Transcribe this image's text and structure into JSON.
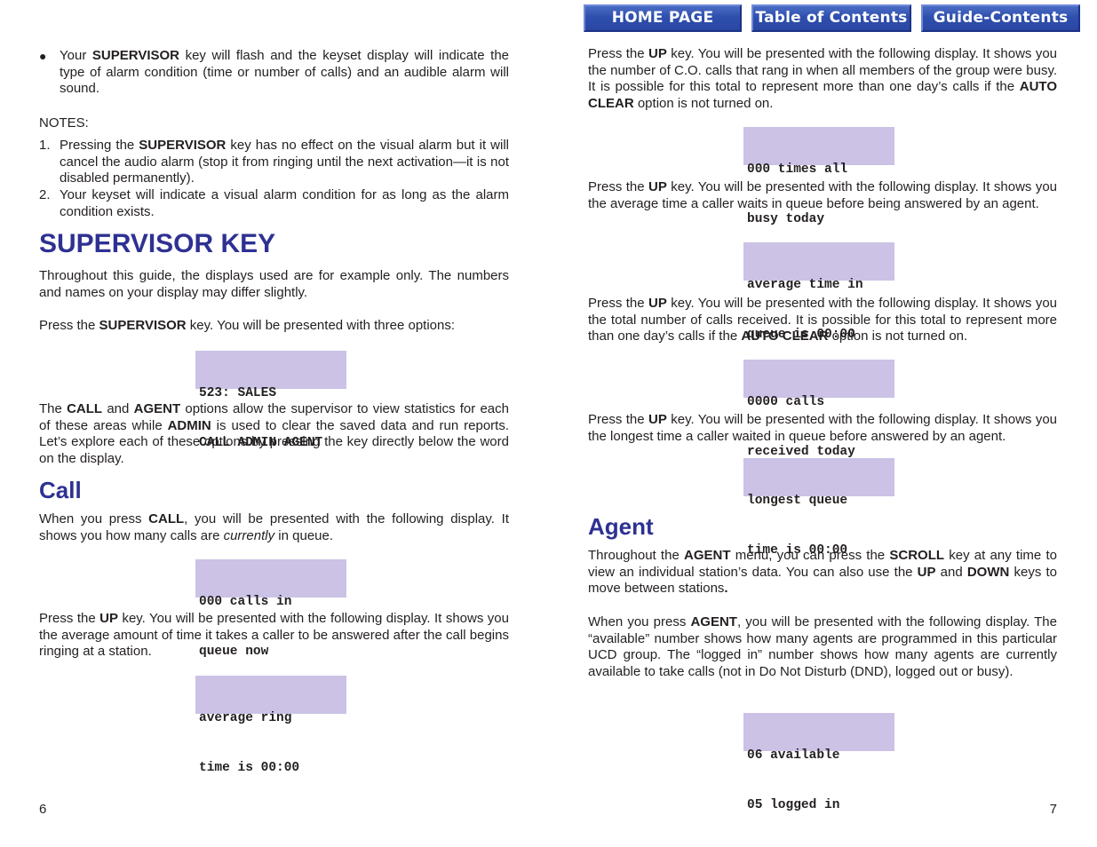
{
  "nav": {
    "home": "HOME PAGE",
    "toc": "Table of Contents",
    "guide": "Guide-Contents"
  },
  "left": {
    "bullet": {
      "pre": "Your ",
      "bold": "SUPERVISOR",
      "post": " key will flash and the keyset display will indicate the type of alarm condition (time or number of calls) and an audible alarm will sound."
    },
    "notes_label": "NOTES:",
    "notes": [
      {
        "num": "1.",
        "pre": "Pressing the ",
        "bold": "SUPERVISOR",
        "post": " key has no effect on the visual alarm but it will cancel the audio alarm (stop it from ringing until the next activation—it is not disabled permanently)."
      },
      {
        "num": "2.",
        "pre": "Your keyset will indicate a visual alarm condition for as long as the alarm condition exists.",
        "bold": "",
        "post": ""
      }
    ],
    "heading": "SUPERVISOR KEY",
    "intro": "Throughout this guide, the displays used are for example only. The numbers and names on your display may differ slightly.",
    "press_supervisor": {
      "pre": "Press the ",
      "bold": "SUPERVISOR",
      "post": " key. You will be presented with three options:"
    },
    "lcd_options": [
      "523: SALES",
      "CALL ADMIN AGENT"
    ],
    "options_para": {
      "t1": "The ",
      "b1": "CALL",
      "t2": " and ",
      "b2": "AGENT",
      "t3": " options allow the supervisor to view statistics for each of these areas while ",
      "b3": "ADMIN",
      "t4": " is used to clear the saved data and run reports. Let’s explore each of these options by pressing the key directly below the word on the display."
    },
    "call_heading": "Call",
    "call_para": {
      "t1": "When you press ",
      "b1": "CALL",
      "t2": ", you will be presented with the following display. It shows you how many calls are ",
      "i1": "currently",
      "t3": " in queue."
    },
    "lcd_calls_in_queue": [
      "000 calls in",
      "queue now"
    ],
    "up_ring_para": {
      "t1": "Press the ",
      "b1": "UP",
      "t2": " key. You will be presented with the following display. It shows you the average amount of time it takes a caller to be answered after the call begins ringing at a station."
    },
    "lcd_avg_ring": [
      "average ring",
      "time is 00:00"
    ],
    "page_number": "6"
  },
  "right": {
    "up_busy_para": {
      "t1": "Press the ",
      "b1": "UP",
      "t2": " key. You will be presented with the following display. It shows you the number of C.O. calls that rang in when all members of the group were busy. It is possible for this total to represent more than one day’s calls if the ",
      "b2": "AUTO CLEAR",
      "t3": " option is not turned on."
    },
    "lcd_all_busy": [
      "000 times all",
      "busy today"
    ],
    "up_avg_queue_para": {
      "t1": "Press the ",
      "b1": "UP",
      "t2": " key. You will be presented with the following display. It shows you the average time a caller waits in queue before being answered by an agent."
    },
    "lcd_avg_queue": [
      "average time in",
      "queue is 00:00"
    ],
    "up_total_para": {
      "t1": "Press the ",
      "b1": "UP",
      "t2": " key. You will be presented with the following display. It shows you the total number of calls received. It is possible for this total to represent more than one day’s calls if the ",
      "b2": "AUTO CLEAR",
      "t3": " option is not turned on."
    },
    "lcd_calls_received": [
      "0000 calls",
      "received today"
    ],
    "up_longest_para": {
      "t1": "Press the ",
      "b1": "UP",
      "t2": " key. You will be presented with the following display. It shows you the longest time a caller waited in queue before answered by an agent."
    },
    "lcd_longest_queue": [
      "longest queue",
      "time is 00:00"
    ],
    "agent_heading": "Agent",
    "agent_para1": {
      "t1": "Throughout the ",
      "b1": "AGENT",
      "t2": " menu, you can press the ",
      "b2": "SCROLL",
      "t3": " key at any time to view an individual station’s data. You can also use the ",
      "b3": "UP",
      "t4": " and ",
      "b4": "DOWN",
      "t5": " keys to move between stations",
      "b5": "."
    },
    "agent_para2": {
      "t1": "When you press ",
      "b1": "AGENT",
      "t2": ", you will be presented with the following display. The “available” number shows how many agents are programmed in this particular UCD group. The “logged in” number shows how many agents are currently available to take calls (not in Do Not Disturb (DND), logged out or busy)."
    },
    "lcd_agents": [
      "06 available",
      "05 logged in"
    ],
    "page_number": "7"
  }
}
